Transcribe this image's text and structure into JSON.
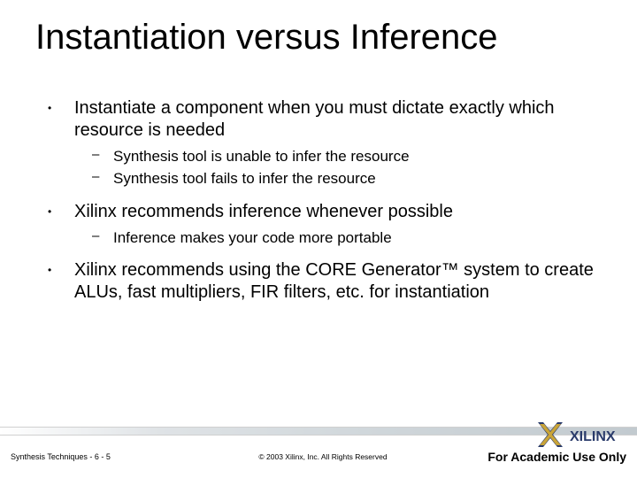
{
  "title": "Instantiation versus Inference",
  "bullets": [
    {
      "text": "Instantiate a component when you must dictate exactly which resource is needed",
      "sub": [
        "Synthesis tool is unable to infer the resource",
        "Synthesis tool fails to infer the resource"
      ]
    },
    {
      "text": "Xilinx recommends inference whenever possible",
      "sub": [
        "Inference makes your code more portable"
      ]
    },
    {
      "text": "Xilinx recommends using the CORE Generator™ system to create ALUs, fast multipliers, FIR filters, etc. for instantiation",
      "sub": []
    }
  ],
  "footer": {
    "left": "Synthesis Techniques  -  6  -  5",
    "center": "© 2003 Xilinx, Inc. All Rights Reserved",
    "right": "For Academic Use Only"
  },
  "logo_text": "XILINX"
}
